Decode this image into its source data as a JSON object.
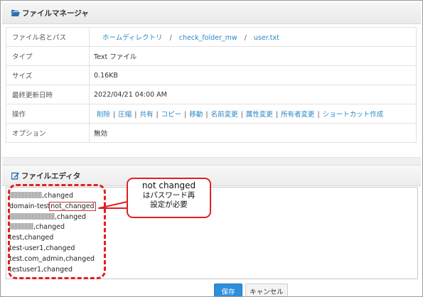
{
  "file_manager": {
    "title": "ファイルマネージャ",
    "rows": [
      {
        "key": "ファイル名とパス",
        "path": [
          "ホームディレクトリ",
          "check_folder_mw",
          "user.txt"
        ],
        "sep": "/"
      },
      {
        "key": "タイプ",
        "value": "Text ファイル"
      },
      {
        "key": "サイズ",
        "value": "0.16KB"
      },
      {
        "key": "最終更新日時",
        "value": "2022/04/21 04:00 AM"
      },
      {
        "key": "操作",
        "ops": [
          "削除",
          "圧縮",
          "共有",
          "コピー",
          "移動",
          "名前変更",
          "属性変更",
          "所有者変更",
          "ショートカット作成"
        ]
      },
      {
        "key": "オプション",
        "value": "無効"
      }
    ]
  },
  "file_editor": {
    "title": "ファイルエディタ",
    "lines": [
      {
        "text": ",changed",
        "redact": true
      },
      {
        "text": "domain-test",
        "highlight": "not_changed"
      },
      {
        "text": ",changed",
        "redact": true
      },
      {
        "text": ",changed",
        "redact": true
      },
      {
        "text": "test,changed"
      },
      {
        "text": "test-user1,changed"
      },
      {
        "text": "test.com_admin,changed"
      },
      {
        "text": "testuser1,changed"
      }
    ]
  },
  "callout": {
    "line1": "not changed",
    "line2": "はパスワード再",
    "line3": "設定が必要"
  },
  "buttons": {
    "save": "保存",
    "cancel": "キャンセル"
  },
  "colors": {
    "link": "#2a86c8",
    "annotation": "#e02020",
    "primary": "#2e8fdb"
  }
}
